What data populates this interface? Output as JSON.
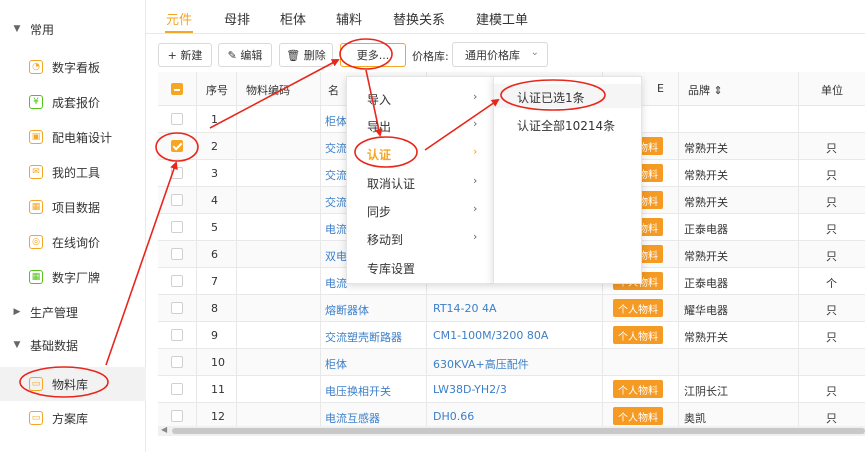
{
  "sidebar": {
    "groups": [
      {
        "label": "常用",
        "caret": "▼"
      },
      {
        "label": "生产管理",
        "caret": "▶"
      },
      {
        "label": "基础数据",
        "caret": "▼"
      }
    ],
    "items": [
      {
        "label": "数字看板",
        "icon": "dashboard-icon",
        "glyph": "◔"
      },
      {
        "label": "成套报价",
        "icon": "yen-icon",
        "glyph": "¥"
      },
      {
        "label": "配电箱设计",
        "icon": "cabinet-icon",
        "glyph": "▣"
      },
      {
        "label": "我的工具",
        "icon": "tools-icon",
        "glyph": "✉"
      },
      {
        "label": "项目数据",
        "icon": "grid-icon",
        "glyph": "▦"
      },
      {
        "label": "在线询价",
        "icon": "inquiry-icon",
        "glyph": "◎"
      },
      {
        "label": "数字厂牌",
        "icon": "apps-icon",
        "glyph": "▦"
      },
      {
        "label": "物料库",
        "icon": "material-icon",
        "glyph": "▭"
      },
      {
        "label": "方案库",
        "icon": "scheme-icon",
        "glyph": "▭"
      }
    ]
  },
  "tabs": [
    "元件",
    "母排",
    "柜体",
    "辅料",
    "替换关系",
    "建模工单"
  ],
  "toolbar": {
    "new": "+ 新建",
    "edit": "✎ 编辑",
    "delete": "🗑 删除",
    "more": "更多...",
    "price_label": "价格库:",
    "price_value": "通用价格库",
    "chevron": "⌄"
  },
  "table": {
    "headers": {
      "seq": "序号",
      "code": "物料编码",
      "name": "名",
      "badge": "E",
      "brand": "品牌 ⇕",
      "unit": "单位"
    },
    "badge_text": "个人物料",
    "rows": [
      {
        "seq": "1",
        "name": "柜体",
        "spec": "",
        "badge": false,
        "brand": "",
        "unit": "",
        "checked": false
      },
      {
        "seq": "2",
        "name": "交流",
        "spec": "",
        "badge": true,
        "brand": "常熟开关",
        "unit": "只",
        "checked": true
      },
      {
        "seq": "3",
        "name": "交流",
        "spec": "",
        "badge": true,
        "brand": "常熟开关",
        "unit": "只",
        "checked": false
      },
      {
        "seq": "4",
        "name": "交流",
        "spec": "",
        "badge": true,
        "brand": "常熟开关",
        "unit": "只",
        "checked": false
      },
      {
        "seq": "5",
        "name": "电流",
        "spec": "",
        "badge": true,
        "brand": "正泰电器",
        "unit": "只",
        "checked": false
      },
      {
        "seq": "6",
        "name": "双电",
        "spec": "",
        "badge": true,
        "brand": "常熟开关",
        "unit": "只",
        "checked": false
      },
      {
        "seq": "7",
        "name": "电流",
        "spec": "",
        "badge": true,
        "brand": "正泰电器",
        "unit": "个",
        "checked": false
      },
      {
        "seq": "8",
        "name": "熔断器体",
        "spec": "RT14-20 4A",
        "badge": true,
        "brand": "耀华电器",
        "unit": "只",
        "checked": false
      },
      {
        "seq": "9",
        "name": "交流塑壳断路器",
        "spec": "CM1-100M/3200 80A",
        "badge": true,
        "brand": "常熟开关",
        "unit": "只",
        "checked": false
      },
      {
        "seq": "10",
        "name": "柜体",
        "spec": "630KVA+高压配件",
        "badge": false,
        "brand": "",
        "unit": "",
        "checked": false
      },
      {
        "seq": "11",
        "name": "电压换相开关",
        "spec": "LW38D-YH2/3",
        "badge": true,
        "brand": "江阴长江",
        "unit": "只",
        "checked": false
      },
      {
        "seq": "12",
        "name": "电流互感器",
        "spec": "DH0.66",
        "badge": true,
        "brand": "奥凯",
        "unit": "只",
        "checked": false
      }
    ]
  },
  "menu": {
    "items": [
      {
        "label": "导入",
        "arrow": "›"
      },
      {
        "label": "导出",
        "arrow": "›"
      },
      {
        "label": "认证",
        "arrow": "›"
      },
      {
        "label": "取消认证",
        "arrow": "›"
      },
      {
        "label": "同步",
        "arrow": "›"
      },
      {
        "label": "移动到",
        "arrow": "›"
      },
      {
        "label": "专库设置",
        "arrow": ""
      }
    ],
    "submenu": [
      "认证已选1条",
      "认证全部10214条"
    ]
  },
  "colors": {
    "accent": "#f5a623",
    "annotation": "#e8271c",
    "link": "#3c7fc9"
  }
}
